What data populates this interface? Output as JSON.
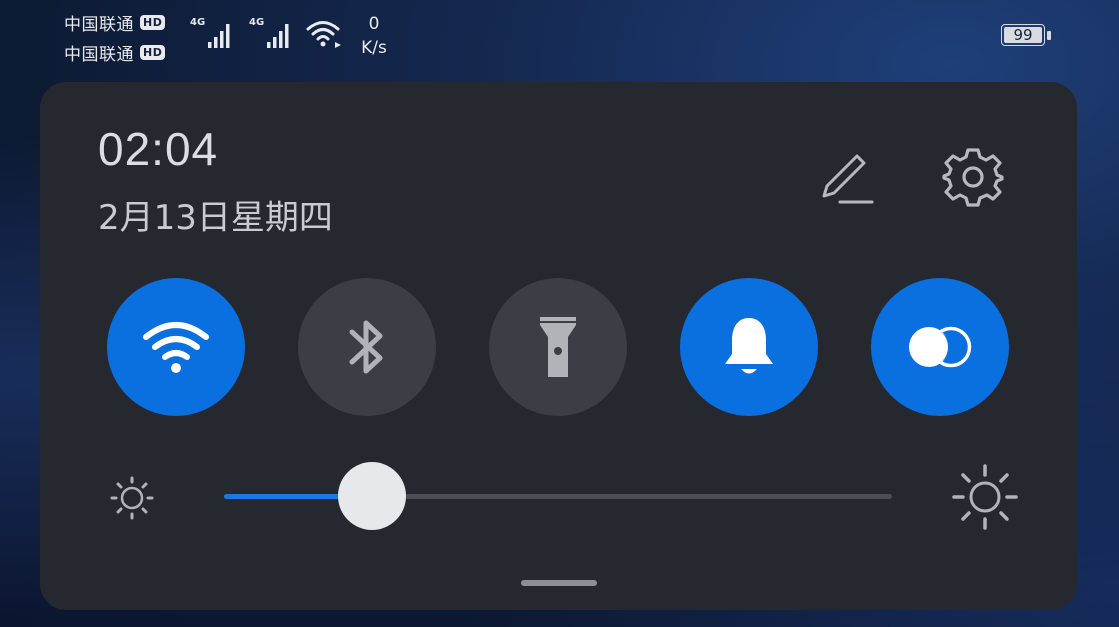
{
  "status_bar": {
    "carriers": [
      {
        "name": "中国联通",
        "badge": "HD"
      },
      {
        "name": "中国联通",
        "badge": "HD"
      }
    ],
    "signals": [
      {
        "generation": "4G",
        "level": 4
      },
      {
        "generation": "4G",
        "level": 4
      }
    ],
    "wifi_icon": "wifi-signal-icon",
    "net_speed_value": "0",
    "net_speed_unit": "K/s",
    "battery_level": "99"
  },
  "panel": {
    "time": "02:04",
    "date": "2月13日星期四",
    "edit_icon": "pencil-icon",
    "settings_icon": "gear-icon",
    "toggles": [
      {
        "id": "wifi",
        "icon": "wifi-icon",
        "state": "on"
      },
      {
        "id": "bluetooth",
        "icon": "bluetooth-icon",
        "state": "off"
      },
      {
        "id": "flashlight",
        "icon": "flashlight-icon",
        "state": "off"
      },
      {
        "id": "sound",
        "icon": "bell-icon",
        "state": "on"
      },
      {
        "id": "eye-comfort",
        "icon": "eye-comfort-icon",
        "state": "on"
      }
    ],
    "brightness": {
      "level_fraction": 0.11,
      "low_icon": "brightness-low-icon",
      "high_icon": "brightness-high-icon"
    }
  },
  "colors": {
    "accent": "#0a6fdf",
    "panel_bg": "#25282e",
    "toggle_off": "#3b3e44",
    "text": "#dadde2"
  }
}
